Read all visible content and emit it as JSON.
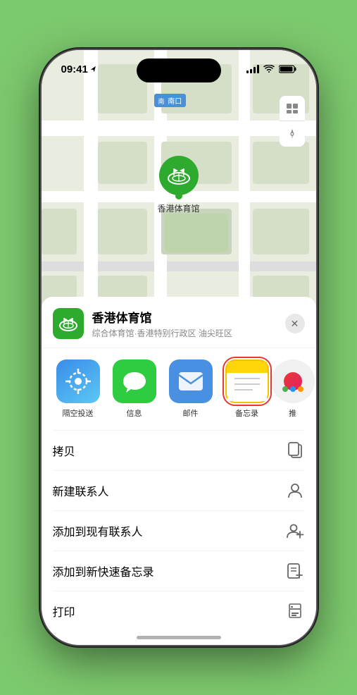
{
  "status_bar": {
    "time": "09:41",
    "location_arrow": "▶",
    "signal": "●●●●",
    "wifi": "wifi",
    "battery": "battery"
  },
  "map": {
    "label": "南口",
    "label_prefix": "南口"
  },
  "venue": {
    "name": "香港体育馆",
    "subtitle": "综合体育馆·香港特别行政区 油尖旺区",
    "pin_label": "香港体育馆",
    "close_label": "✕"
  },
  "share_apps": [
    {
      "id": "airdrop",
      "label": "隔空投送"
    },
    {
      "id": "message",
      "label": "信息"
    },
    {
      "id": "mail",
      "label": "邮件"
    },
    {
      "id": "notes",
      "label": "备忘录"
    },
    {
      "id": "more",
      "label": "推"
    }
  ],
  "actions": [
    {
      "id": "copy",
      "label": "拷贝",
      "icon": "copy"
    },
    {
      "id": "new-contact",
      "label": "新建联系人",
      "icon": "person"
    },
    {
      "id": "add-existing",
      "label": "添加到现有联系人",
      "icon": "person-plus"
    },
    {
      "id": "add-notes",
      "label": "添加到新快速备忘录",
      "icon": "notes-add"
    },
    {
      "id": "print",
      "label": "打印",
      "icon": "printer"
    }
  ],
  "colors": {
    "green": "#2eaa2e",
    "selected_border": "#e53935",
    "map_bg": "#e8ede0"
  }
}
